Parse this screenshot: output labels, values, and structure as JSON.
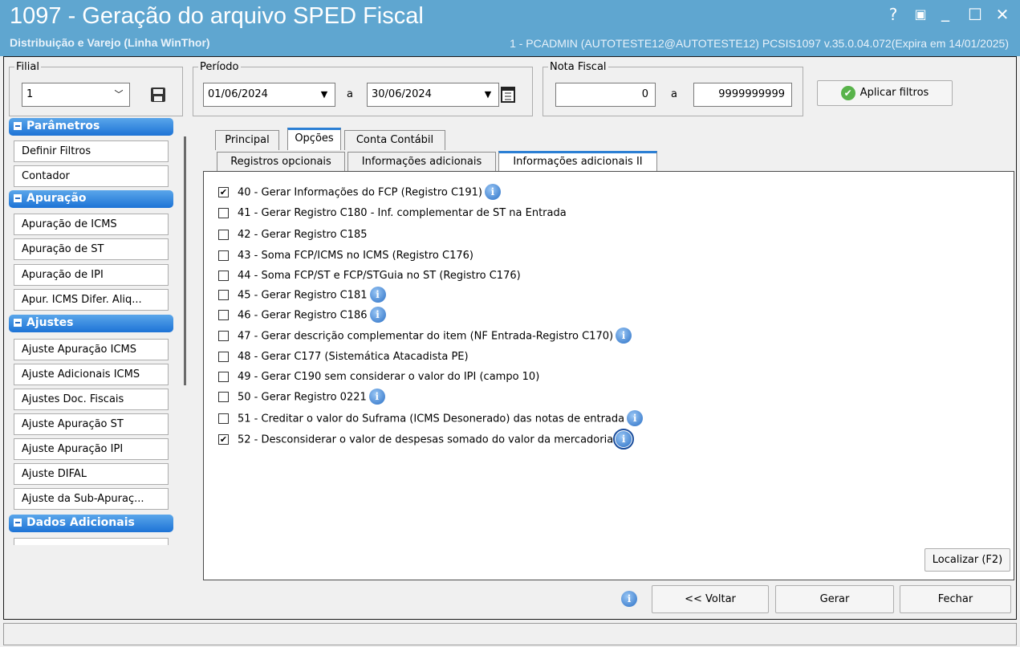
{
  "window": {
    "title": "1097 - Geração do arquivo SPED Fiscal",
    "subtitle": "Distribuição e Varejo (Linha WinThor)",
    "user_info": "1 - PCADMIN (AUTOTESTE12@AUTOTESTE12)   PCSIS1097  v.35.0.04.072(Expira em 14/01/2025)",
    "controls": [
      "?",
      "▣",
      "_",
      "☐",
      "✕"
    ]
  },
  "filters": {
    "filial_label": "Filial",
    "filial_value": "1",
    "periodo_label": "Período",
    "date_from": "01/06/2024",
    "date_sep": "a",
    "date_to": "30/06/2024",
    "nota_label": "Nota Fiscal",
    "nota_from": "0",
    "nota_sep": "a",
    "nota_to": "9999999999",
    "apply_label": "Aplicar filtros",
    "apply_accel": "A"
  },
  "sidebar": {
    "sections": [
      {
        "title": "Parâmetros",
        "items": [
          "Definir Filtros",
          "Contador"
        ]
      },
      {
        "title": "Apuração",
        "items": [
          "Apuração de ICMS",
          "Apuração de ST",
          "Apuração de IPI",
          "Apur. ICMS Difer. Aliq..."
        ]
      },
      {
        "title": "Ajustes",
        "items": [
          "Ajuste Apuração ICMS",
          "Ajuste Adicionais ICMS",
          "Ajustes Doc. Fiscais",
          "Ajuste Apuração ST",
          "Ajuste Apuração IPI",
          "Ajuste DIFAL",
          "Ajuste da Sub-Apuraç..."
        ]
      },
      {
        "title": "Dados Adicionais",
        "items": []
      }
    ]
  },
  "tabs": {
    "main": [
      "Principal",
      "Opções",
      "Conta Contábil"
    ],
    "main_active": 1,
    "sub": [
      "Registros opcionais",
      "Informações adicionais",
      "Informações adicionais II"
    ],
    "sub_active": 2
  },
  "options": [
    {
      "label": "40 - Gerar Informações do FCP (Registro C191)",
      "checked": true,
      "info": true
    },
    {
      "label": "41 - Gerar Registro C180 - Inf. complementar de ST na Entrada",
      "checked": false,
      "info": false
    },
    {
      "label": "42 - Gerar Registro C185",
      "checked": false,
      "info": false
    },
    {
      "label": "43 - Soma FCP/ICMS no ICMS (Registro C176)",
      "checked": false,
      "info": false
    },
    {
      "label": "44 - Soma FCP/ST e FCP/STGuia no ST (Registro C176)",
      "checked": false,
      "info": false
    },
    {
      "label": "45 - Gerar Registro C181",
      "checked": false,
      "info": true
    },
    {
      "label": "46 - Gerar Registro C186",
      "checked": false,
      "info": true
    },
    {
      "label": "47 - Gerar descrição complementar do item (NF Entrada-Registro C170)",
      "checked": false,
      "info": true
    },
    {
      "label": "48 - Gerar C177 (Sistemática Atacadista PE)",
      "checked": false,
      "info": false
    },
    {
      "label": "49 - Gerar C190 sem considerar o valor do IPI (campo 10)",
      "checked": false,
      "info": false
    },
    {
      "label": "50 - Gerar Registro 0221",
      "checked": false,
      "info": true
    },
    {
      "label": "51 - Creditar o valor do Suframa (ICMS Desonerado) das notas de entrada",
      "checked": false,
      "info": true
    },
    {
      "label": "52 - Desconsiderar o valor de despesas somado do valor da mercadoria",
      "checked": true,
      "info": true,
      "info_selected": true
    }
  ],
  "buttons": {
    "localizar": "Localizar (F2)",
    "voltar": "<< Voltar",
    "gerar": "Gerar",
    "fechar": "Fechar"
  },
  "colors": {
    "titlebar": "#5fa6d0",
    "section_header": "#1d73d6",
    "tab_accent": "#2b7fd4"
  },
  "icons": [
    "save-icon",
    "calendar-icon",
    "check-circle-icon",
    "info-icon",
    "minus-icon"
  ]
}
